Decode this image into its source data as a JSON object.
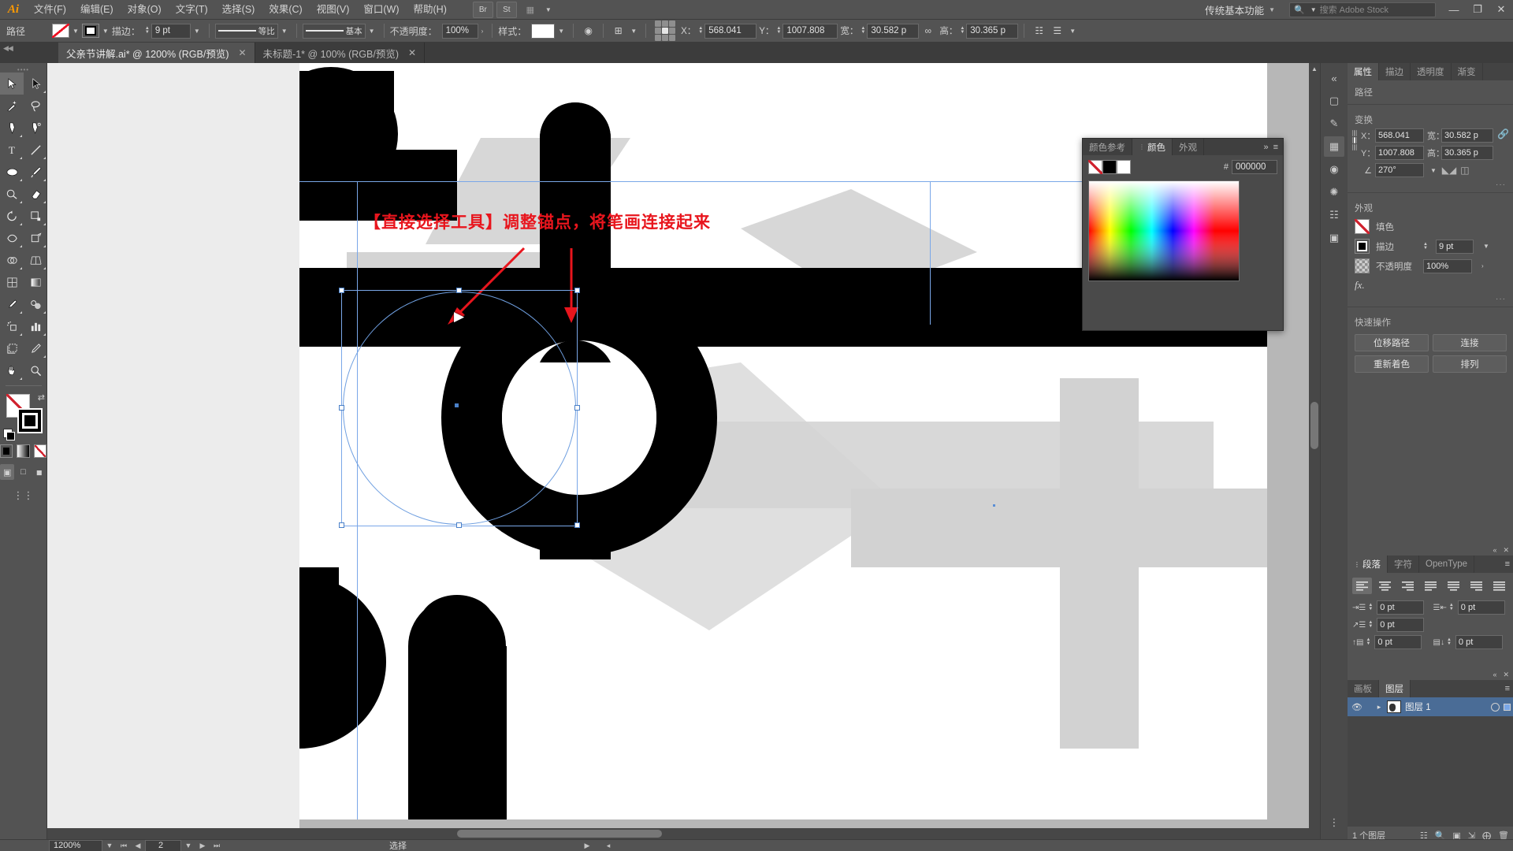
{
  "app": {
    "name": "Adobe Illustrator",
    "logo": "Ai"
  },
  "menubar": {
    "items": [
      {
        "label": "文件(F)"
      },
      {
        "label": "编辑(E)"
      },
      {
        "label": "对象(O)"
      },
      {
        "label": "文字(T)"
      },
      {
        "label": "选择(S)"
      },
      {
        "label": "效果(C)"
      },
      {
        "label": "视图(V)"
      },
      {
        "label": "窗口(W)"
      },
      {
        "label": "帮助(H)"
      }
    ],
    "right_icons": [
      {
        "name": "bridge-icon",
        "glyph": "Br"
      },
      {
        "name": "stock-icon",
        "glyph": "St"
      },
      {
        "name": "arrange-documents-icon",
        "glyph": "▦"
      }
    ],
    "workspace": "传统基本功能",
    "search_placeholder": "搜索 Adobe Stock",
    "window_controls": [
      "—",
      "❐",
      "✕"
    ]
  },
  "controlbar": {
    "title": "路径",
    "fill_label": "",
    "stroke_label": "描边：",
    "stroke_weight": "9 pt",
    "stroke_profile": "等比",
    "brush_definition": "基本",
    "opacity_label": "不透明度：",
    "opacity_value": "100%",
    "style_label": "样式：",
    "x_label": "X：",
    "x_value": "568.041",
    "y_label": "Y：",
    "y_value": "1007.808",
    "w_label": "宽：",
    "w_value": "30.582 p",
    "h_label": "高：",
    "h_value": "30.365 p"
  },
  "tabs": [
    {
      "title": "父亲节讲解.ai* @ 1200% (RGB/预览)",
      "active": true,
      "close": "✕"
    },
    {
      "title": "未标题-1* @ 100% (RGB/预览)",
      "active": false,
      "close": "✕"
    }
  ],
  "toolbar": {
    "tools": [
      {
        "name": "selection-tool",
        "selected": true
      },
      {
        "name": "direct-selection-tool",
        "selected": false
      },
      {
        "name": "magic-wand-tool",
        "selected": false
      },
      {
        "name": "lasso-tool",
        "selected": false
      },
      {
        "name": "pen-tool",
        "selected": false
      },
      {
        "name": "curvature-tool",
        "selected": false
      },
      {
        "name": "type-tool",
        "selected": false
      },
      {
        "name": "line-segment-tool",
        "selected": false
      },
      {
        "name": "ellipse-tool",
        "selected": false
      },
      {
        "name": "paintbrush-tool",
        "selected": false
      },
      {
        "name": "shaper-tool",
        "selected": false
      },
      {
        "name": "eraser-tool",
        "selected": false
      },
      {
        "name": "rotate-tool",
        "selected": false
      },
      {
        "name": "scale-tool",
        "selected": false
      },
      {
        "name": "width-tool",
        "selected": false
      },
      {
        "name": "free-transform-tool",
        "selected": false
      },
      {
        "name": "shape-builder-tool",
        "selected": false
      },
      {
        "name": "perspective-grid-tool",
        "selected": false
      },
      {
        "name": "mesh-tool",
        "selected": false
      },
      {
        "name": "gradient-tool",
        "selected": false
      },
      {
        "name": "eyedropper-tool",
        "selected": false
      },
      {
        "name": "blend-tool",
        "selected": false
      },
      {
        "name": "symbol-sprayer-tool",
        "selected": false
      },
      {
        "name": "column-graph-tool",
        "selected": false
      },
      {
        "name": "artboard-tool",
        "selected": false
      },
      {
        "name": "slice-tool",
        "selected": false
      },
      {
        "name": "hand-tool",
        "selected": false
      },
      {
        "name": "zoom-tool",
        "selected": false
      }
    ],
    "fill_color": "none",
    "stroke_color": "#000000",
    "color_modes": [
      "color",
      "gradient",
      "none"
    ],
    "screen_modes": [
      "normal",
      "full-menu",
      "full"
    ]
  },
  "canvas": {
    "annotation": "【直接选择工具】调整锚点，将笔画连接起来",
    "annotation_color": "#e8151d",
    "artwork_letter": "d",
    "artwork_color": "#000000"
  },
  "color_panel": {
    "tabs": [
      {
        "label": "颜色参考",
        "active": false
      },
      {
        "label": "颜色",
        "active": true
      },
      {
        "label": "外观",
        "active": false
      }
    ],
    "menu_glyph": "≡",
    "collapse_glyph": "»",
    "hash": "#",
    "hex": "000000",
    "swatches": [
      "none",
      "#000000",
      "#ffffff"
    ]
  },
  "right_panel": {
    "tabs": [
      {
        "label": "属性",
        "active": true
      },
      {
        "label": "描边",
        "active": false
      },
      {
        "label": "透明度",
        "active": false
      },
      {
        "label": "渐变",
        "active": false
      }
    ],
    "path_section": "路径",
    "transform_section": "变换",
    "x_label": "X：",
    "x_value": "568.041",
    "y_label": "Y：",
    "y_value": "1007.808",
    "w_label": "宽：",
    "w_value": "30.582 p",
    "h_label": "高：",
    "h_value": "30.365 p",
    "angle_value": "270°",
    "appearance_section": "外观",
    "fill_label": "填色",
    "stroke_label": "描边",
    "stroke_value": "9 pt",
    "opacity_label": "不透明度",
    "opacity_value": "100%",
    "fx_label": "fx.",
    "quick_actions_title": "快速操作",
    "quick_actions": [
      "位移路径",
      "连接",
      "重新着色",
      "排列"
    ],
    "more_dots": "···"
  },
  "paragraph_panel": {
    "tabs": [
      {
        "label": "段落",
        "active": true
      },
      {
        "label": "字符",
        "active": false
      },
      {
        "label": "OpenType",
        "active": false
      }
    ],
    "menu_glyph": "≡",
    "align_buttons": [
      "align-left",
      "align-center",
      "align-right",
      "justify-last-left",
      "justify-last-center",
      "justify-last-right",
      "justify-all"
    ],
    "fields": [
      {
        "name": "indent-left",
        "value": "0 pt"
      },
      {
        "name": "indent-right",
        "value": "0 pt"
      },
      {
        "name": "indent-first-line",
        "value": "0 pt"
      },
      {
        "name": "space-before",
        "value": "0 pt"
      },
      {
        "name": "space-after",
        "value": "0 pt"
      }
    ]
  },
  "layers_panel": {
    "tabs": [
      {
        "label": "画板",
        "active": false
      },
      {
        "label": "图层",
        "active": true
      }
    ],
    "menu_glyph": "≡",
    "rows": [
      {
        "name": "图层 1",
        "visible": true,
        "locked": false
      }
    ],
    "footer_count": "1 个图层"
  },
  "statusbar": {
    "zoom": "1200%",
    "page": "2",
    "status_text": "选择"
  }
}
